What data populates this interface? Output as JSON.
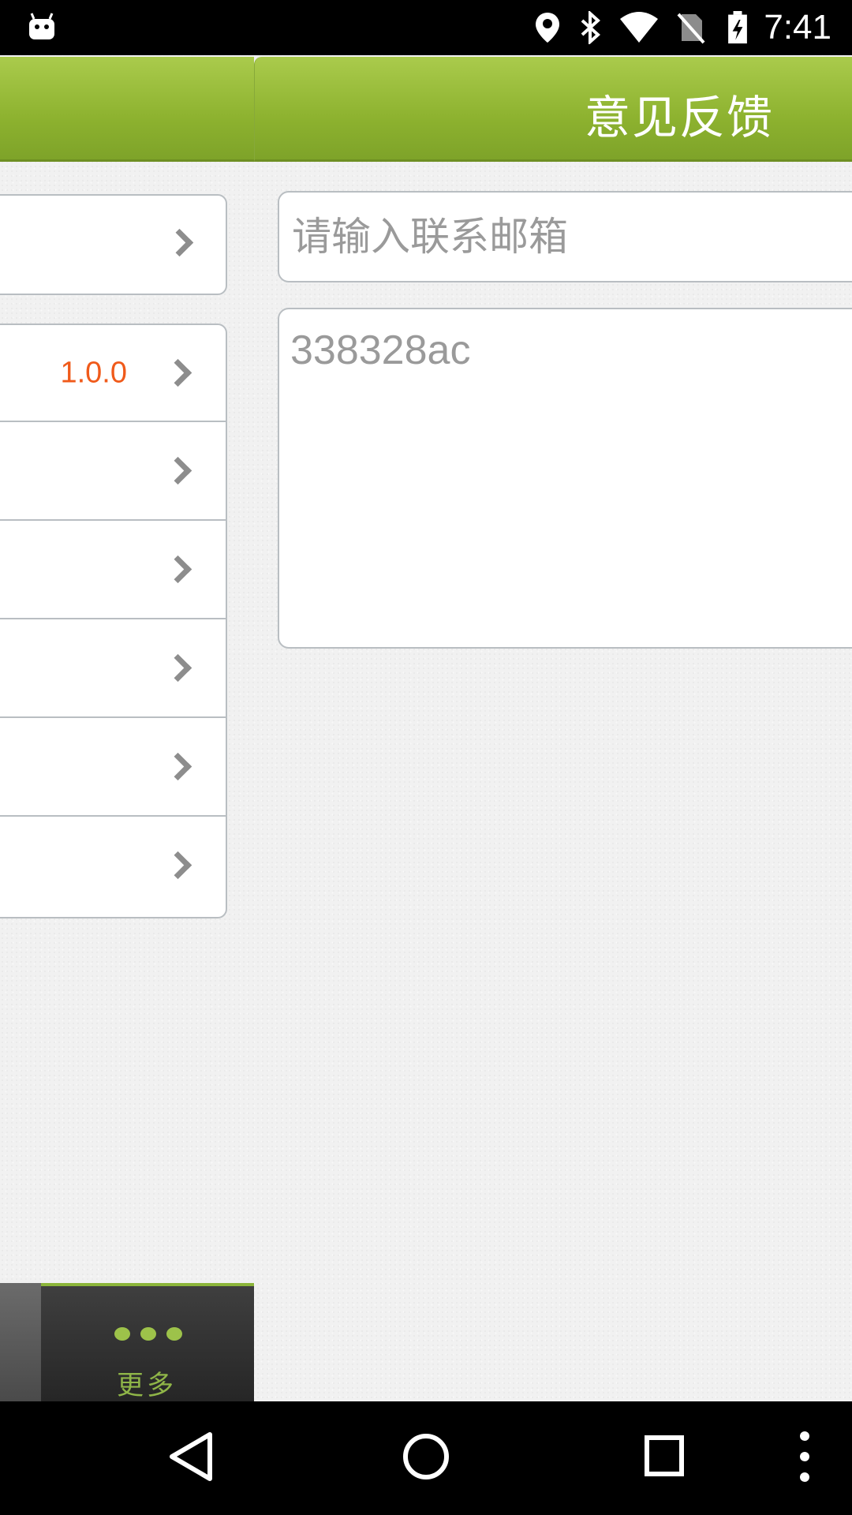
{
  "status_bar": {
    "time": "7:41",
    "icons": [
      "android-robot-icon",
      "location-icon",
      "bluetooth-icon",
      "wifi-icon",
      "no-sim-icon",
      "battery-charging-icon"
    ]
  },
  "sidebar": {
    "rows": [
      {
        "value": ""
      },
      {
        "value": "1.0.0"
      },
      {
        "value": ""
      },
      {
        "value": ""
      },
      {
        "value": ""
      },
      {
        "value": ""
      },
      {
        "value": ""
      }
    ],
    "more_label": "更多"
  },
  "feedback": {
    "title": "意见反馈",
    "email_placeholder": "请输入联系邮箱",
    "content_value": "338328ac"
  },
  "colors": {
    "header_green": "#8db22f",
    "version_orange": "#f05a1a",
    "accent_green": "#9dc24a"
  }
}
